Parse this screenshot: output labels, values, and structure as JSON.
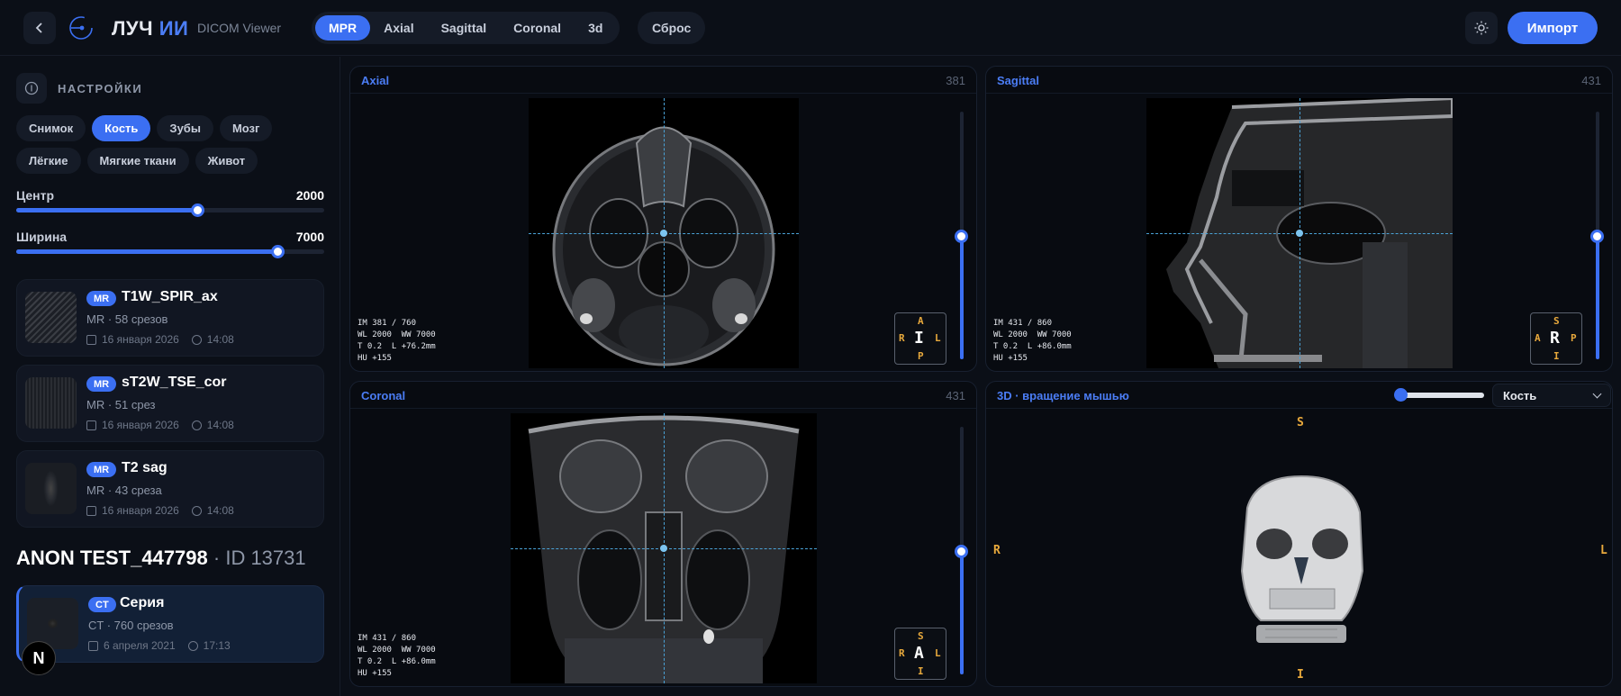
{
  "app": {
    "logo_main": "ЛУЧ",
    "logo_ai": "ИИ",
    "logo_sub": "DICOM Viewer"
  },
  "topbar": {
    "view_tabs": [
      "MPR",
      "Axial",
      "Sagittal",
      "Coronal",
      "3d"
    ],
    "active_view": "MPR",
    "reset_label": "Сброс",
    "import_label": "Импорт"
  },
  "sidebar": {
    "settings_label": "НАСТРОЙКИ",
    "presets": [
      "Снимок",
      "Кость",
      "Зубы",
      "Мозг",
      "Лёгкие",
      "Мягкие ткани",
      "Живот"
    ],
    "active_preset": "Кость",
    "center": {
      "label": "Центр",
      "value": "2000",
      "fraction": 0.59
    },
    "width": {
      "label": "Ширина",
      "value": "7000",
      "fraction": 0.85
    },
    "series": [
      {
        "badge": "MR",
        "name": "T1W_SPIR_ax",
        "meta": "MR · 58 срезов",
        "date": "16 января 2026",
        "time": "14:08"
      },
      {
        "badge": "MR",
        "name": "sT2W_TSE_cor",
        "meta": "MR · 51 срез",
        "date": "16 января 2026",
        "time": "14:08"
      },
      {
        "badge": "MR",
        "name": "T2 sag",
        "meta": "MR · 43 среза",
        "date": "16 января 2026",
        "time": "14:08"
      }
    ],
    "patient_name": "ANON TEST_447798",
    "patient_id": "· ID 13731",
    "active_series": {
      "badge": "CT",
      "name": "Серия",
      "meta": "CT · 760 срезов",
      "date": "6 апреля 2021",
      "time": "17:13"
    },
    "n_badge": "N"
  },
  "panels": {
    "axial": {
      "title": "Axial",
      "count": "381",
      "info": "IM 381 / 760\nWL 2000  WW 7000\nT 0.2  L +76.2mm\nHU +155",
      "orient": {
        "center": "I",
        "top": "A",
        "bottom": "P",
        "left": "R",
        "right": "L"
      },
      "slider_fraction": 0.5
    },
    "sagittal": {
      "title": "Sagittal",
      "count": "431",
      "info": "IM 431 / 860\nWL 2000  WW 7000\nT 0.2  L +86.0mm\nHU +155",
      "orient": {
        "center": "R",
        "top": "S",
        "bottom": "I",
        "left": "A",
        "right": "P"
      },
      "slider_fraction": 0.5
    },
    "coronal": {
      "title": "Coronal",
      "count": "431",
      "info": "IM 431 / 860\nWL 2000  WW 7000\nT 0.2  L +86.0mm\nHU +155",
      "orient": {
        "center": "A",
        "top": "S",
        "bottom": "I",
        "left": "R",
        "right": "L"
      },
      "slider_fraction": 0.5
    },
    "three_d": {
      "title": "3D · вращение мышью",
      "preset": "Кость",
      "rotation_fraction": 0.0,
      "orient": {
        "top": "S",
        "bottom": "I",
        "left": "R",
        "right": "L"
      }
    }
  }
}
